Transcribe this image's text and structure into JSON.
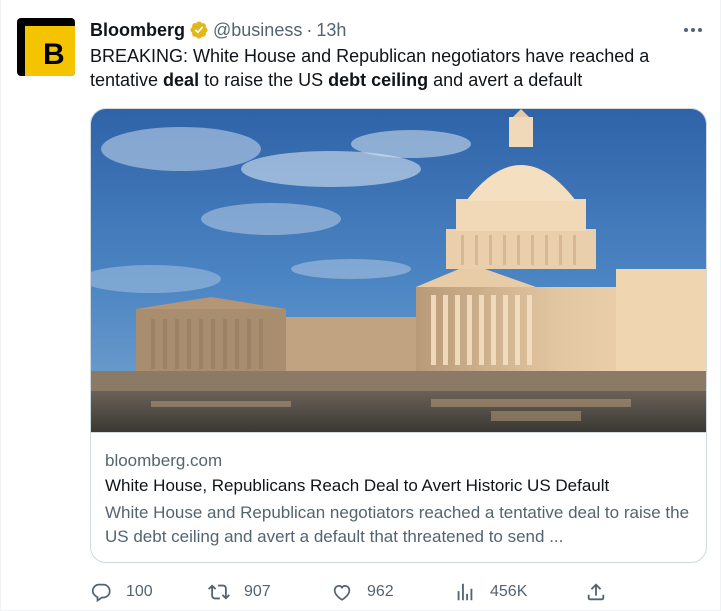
{
  "tweet": {
    "display_name": "Bloomberg",
    "handle": "@business",
    "separator": "·",
    "time": "13h",
    "avatar_letter": "B",
    "text_parts": {
      "p1": "BREAKING: White House and Republican negotiators have reached a tentative ",
      "b1": "deal",
      "p2": " to raise the US ",
      "b2": "debt ceiling",
      "p3": " and avert a default"
    }
  },
  "card": {
    "domain": "bloomberg.com",
    "title": "White House, Republicans Reach Deal to Avert Historic US Default",
    "description": "White House and Republican negotiators reached a tentative deal to raise the US debt ceiling and avert a default that threatened to send ..."
  },
  "actions": {
    "replies": "100",
    "retweets": "907",
    "likes": "962",
    "views": "456K"
  },
  "colors": {
    "avatar_yellow": "#f5c400",
    "verified_gold": "#e2b719",
    "secondary_text": "#536471"
  },
  "icons": [
    "verified-badge-icon",
    "more-icon",
    "reply-icon",
    "retweet-icon",
    "like-icon",
    "views-icon",
    "share-icon"
  ]
}
